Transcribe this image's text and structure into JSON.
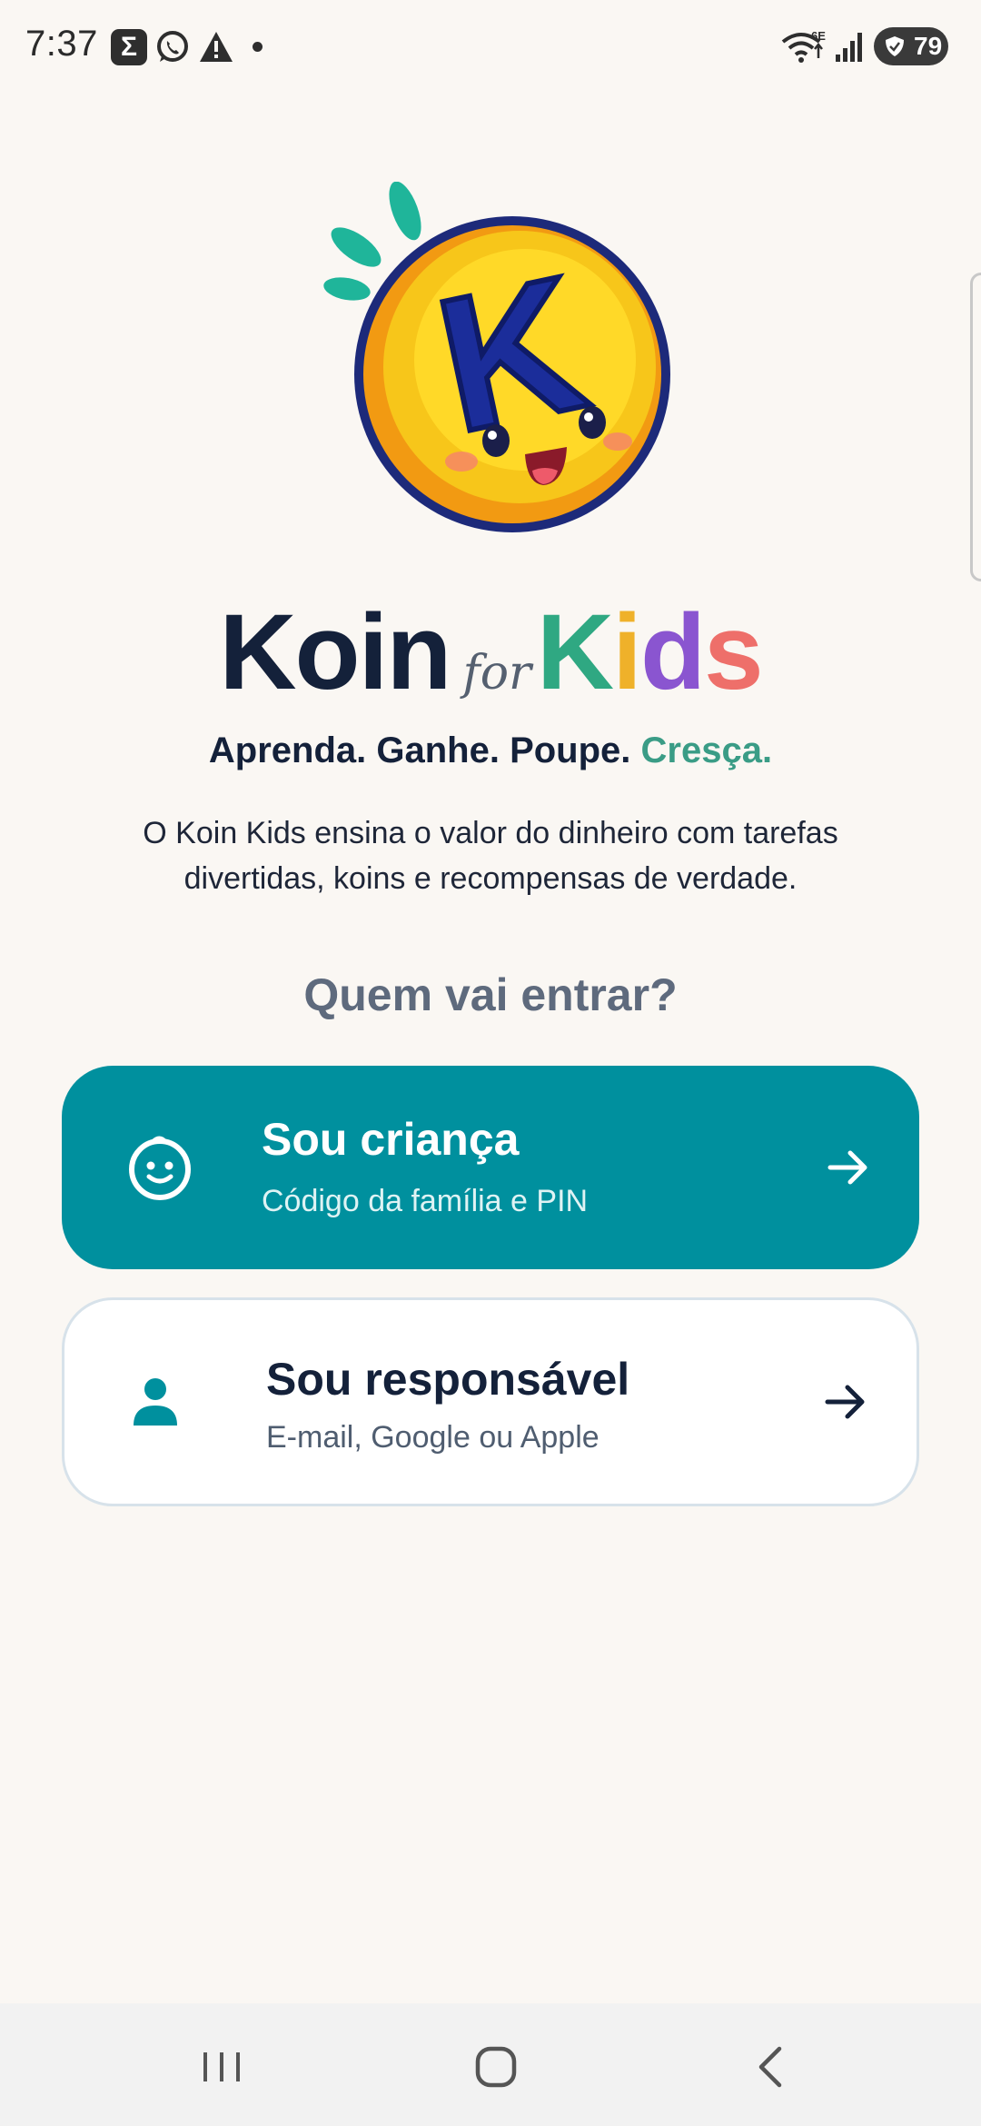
{
  "status_bar": {
    "time": "7:37",
    "sigma_glyph": "Σ",
    "network_badge": "6E",
    "battery_level": "79",
    "icons": [
      "sigma-app-icon",
      "whatsapp-icon",
      "warning-icon",
      "notification-dot",
      "wifi-icon",
      "signal-icon",
      "battery-icon"
    ]
  },
  "logo": {
    "mascot_letter": "K",
    "brand_part1": "Koin",
    "brand_connector": "for",
    "brand_part2_letters": [
      "K",
      "i",
      "d",
      "s"
    ],
    "brand_colors": [
      "#2fa882",
      "#efb12a",
      "#8a55d0",
      "#ee6f6a"
    ]
  },
  "tagline": {
    "main": "Aprenda. Ganhe. Poupe.",
    "accent": "Cresça."
  },
  "description": "O Koin Kids ensina o valor do dinheiro com tarefas divertidas, koins e recompensas de verdade.",
  "question": "Quem vai entrar?",
  "options": {
    "child": {
      "title": "Sou criança",
      "subtitle": "Código da família e PIN",
      "icon": "child-face-icon",
      "color": "#00909e"
    },
    "parent": {
      "title": "Sou responsável",
      "subtitle": "E-mail, Google ou Apple",
      "icon": "person-icon",
      "color": "#ffffff"
    }
  },
  "nav_bar": {
    "icons": [
      "recents-icon",
      "home-icon",
      "back-icon"
    ]
  }
}
